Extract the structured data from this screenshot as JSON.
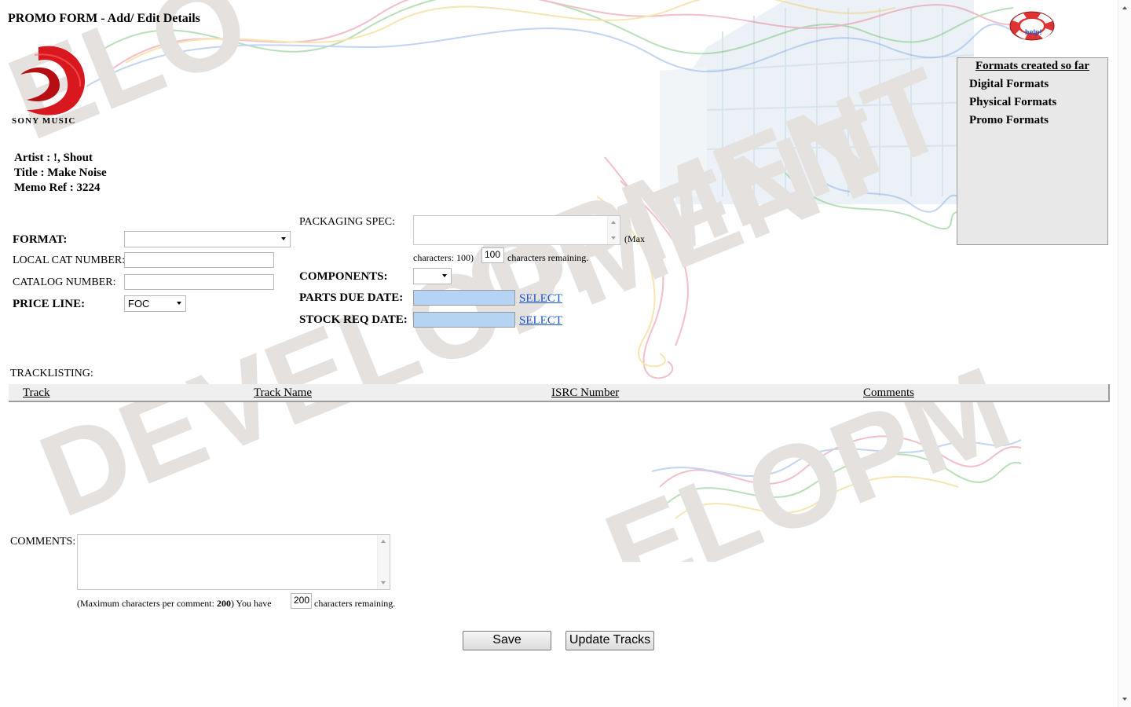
{
  "header": {
    "title_prefix": "PROMO FORM",
    "title_suffix": " - Add/ Edit Details",
    "help_label": "help!"
  },
  "logo": {
    "text": "SONY MUSIC"
  },
  "watermark": {
    "text": "DEVELOPMENT"
  },
  "meta": {
    "artist": "Artist : !, Shout",
    "title": "Title : Make Noise",
    "memo": "Memo Ref : 3224"
  },
  "formats_panel": {
    "heading": "Formats created so far",
    "items": [
      "Digital Formats",
      "Physical Formats",
      "Promo Formats"
    ]
  },
  "form": {
    "format_label": "FORMAT:",
    "format_value": "",
    "local_cat_label": "LOCAL CAT NUMBER:",
    "local_cat_value": "",
    "catalog_label": "CATALOG NUMBER:",
    "catalog_value": "",
    "price_line_label": "PRICE LINE:",
    "price_line_value": "FOC",
    "packaging_label": "PACKAGING SPEC:",
    "packaging_value": "",
    "packaging_max_open": "(Max",
    "packaging_max_chars": "characters: 100)",
    "packaging_remaining": "100",
    "packaging_remaining_suffix": "characters remaining.",
    "components_label": "COMPONENTS:",
    "components_value": "",
    "parts_due_label": "PARTS DUE DATE:",
    "parts_due_value": "",
    "stock_req_label": "STOCK REQ DATE:",
    "stock_req_value": "",
    "select_link": "SELECT"
  },
  "tracklisting": {
    "label": "TRACKLISTING:",
    "columns": [
      "Track",
      "Track Name",
      "ISRC Number",
      "Comments"
    ]
  },
  "comments": {
    "label": "COMMENTS:",
    "value": "",
    "hint_prefix": "(Maximum characters per comment: ",
    "hint_max": "200",
    "hint_mid": ") You have",
    "remaining": "200",
    "hint_suffix": "characters remaining."
  },
  "buttons": {
    "save": "Save",
    "update_tracks": "Update Tracks"
  }
}
